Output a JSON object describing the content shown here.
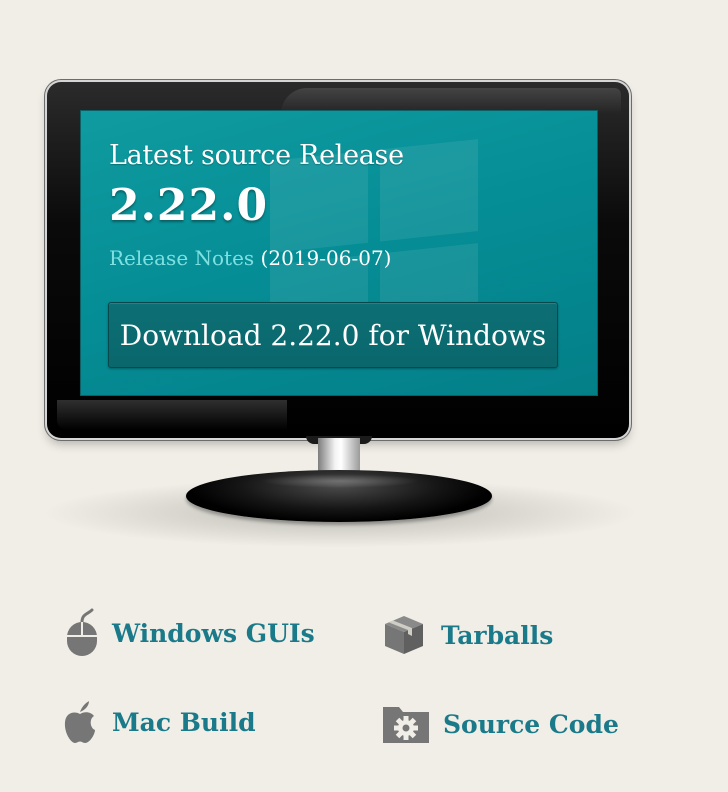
{
  "release": {
    "heading": "Latest source Release",
    "version": "2.22.0",
    "notes_label": "Release Notes",
    "date": "(2019-06-07)",
    "download_label": "Download 2.22.0 for Windows"
  },
  "links": [
    {
      "label": "Windows GUIs",
      "icon": "mouse-icon"
    },
    {
      "label": "Tarballs",
      "icon": "package-icon"
    },
    {
      "label": "Mac Build",
      "icon": "apple-icon"
    },
    {
      "label": "Source Code",
      "icon": "gear-folder-icon"
    }
  ],
  "colors": {
    "background": "#f0eee6",
    "screen": "#058d95",
    "link": "#1b7a8a",
    "notes_link": "#7fe0e2",
    "icon": "#767676"
  }
}
